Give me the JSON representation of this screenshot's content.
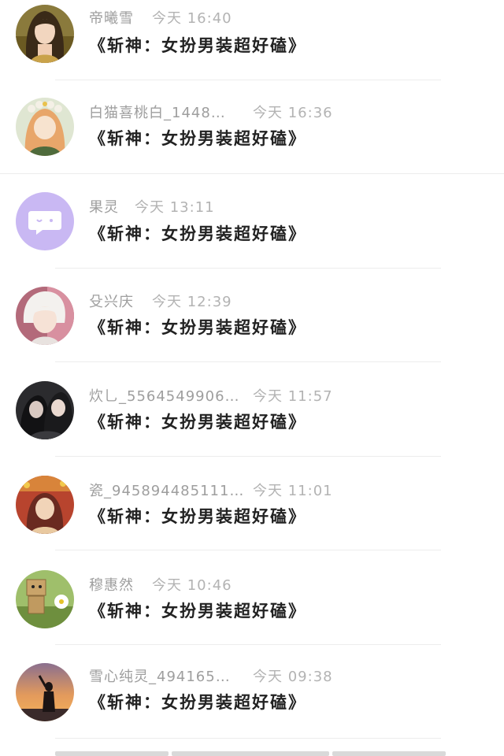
{
  "comments": [
    {
      "user": "帝曦雪",
      "time": "今天 16:40",
      "text": "《斩神：女扮男装超好磕》",
      "avatar": "long-hair-woman-avatar"
    },
    {
      "user": "白猫喜桃白_1448…",
      "time": "今天 16:36",
      "text": "《斩神：女扮男装超好磕》",
      "avatar": "flower-crown-girl-avatar"
    },
    {
      "user": "果灵",
      "time": "今天 13:11",
      "text": "《斩神：女扮男装超好磕》",
      "avatar": "default-chat-bubble-avatar",
      "avatar_color": "#c9b8f3"
    },
    {
      "user": "殳兴庆",
      "time": "今天 12:39",
      "text": "《斩神：女扮男装超好磕》",
      "avatar": "white-hair-boy-avatar"
    },
    {
      "user": "炊乚_5564549906…",
      "time": "今天 11:57",
      "text": "《斩神：女扮男装超好磕》",
      "avatar": "couple-dark-avatar"
    },
    {
      "user": "瓷_945894485111…",
      "time": "今天 11:01",
      "text": "《斩神：女扮男装超好磕》",
      "avatar": "red-orange-illustration-avatar"
    },
    {
      "user": "穆惠然",
      "time": "今天 10:46",
      "text": "《斩神：女扮男装超好磕》",
      "avatar": "cardboard-robot-flower-avatar"
    },
    {
      "user": "雪心纯灵_494165…",
      "time": "今天 09:38",
      "text": "《斩神：女扮男装超好磕》",
      "avatar": "sunset-silhouette-avatar"
    }
  ],
  "colors": {
    "username": "#9e9e9e",
    "timestamp": "#b3b3b3",
    "comment_text": "#222222",
    "divider": "#ededed"
  }
}
